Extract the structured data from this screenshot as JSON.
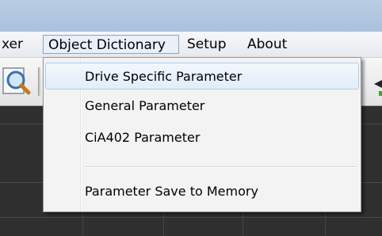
{
  "menubar": {
    "items": [
      {
        "label": "xer"
      },
      {
        "label": "Object Dictionary"
      },
      {
        "label": "Setup"
      },
      {
        "label": "About"
      }
    ]
  },
  "dropdown": {
    "items": [
      {
        "label": "Drive Specific Parameter"
      },
      {
        "label": "General Parameter"
      },
      {
        "label": "CiA402 Parameter"
      },
      {
        "label": "Parameter Save to Memory"
      }
    ]
  },
  "icons": {
    "toolbar_left": "magnifier-icon",
    "toolbar_right": "arrow-icon"
  },
  "colors": {
    "menu_highlight": "#e9f0f8",
    "hover_border": "#aecdec",
    "titlebar": "#b9cde4"
  }
}
